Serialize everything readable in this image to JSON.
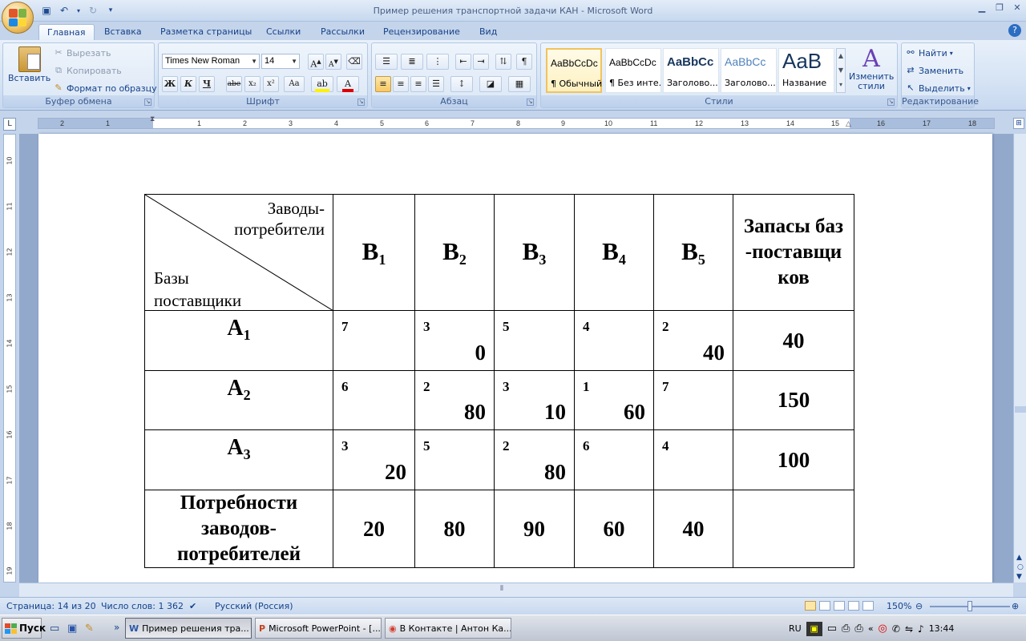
{
  "window": {
    "title": "Пример решения транспортной задачи КАН - Microsoft Word"
  },
  "tabs": [
    "Главная",
    "Вставка",
    "Разметка страницы",
    "Ссылки",
    "Рассылки",
    "Рецензирование",
    "Вид"
  ],
  "ribbon": {
    "clipboard": {
      "paste": "Вставить",
      "cut": "Вырезать",
      "copy": "Копировать",
      "format_painter": "Формат по образцу",
      "label": "Буфер обмена"
    },
    "font": {
      "name": "Times New Roman",
      "size": "14",
      "label": "Шрифт",
      "bold": "Ж",
      "italic": "К",
      "underline": "Ч",
      "strike": "abe",
      "subscript": "x₂",
      "superscript": "x²",
      "change_case": "Aa"
    },
    "paragraph": {
      "label": "Абзац"
    },
    "styles": {
      "label": "Стили",
      "items": [
        {
          "preview": "AaBbCcDc",
          "name": "¶ Обычный"
        },
        {
          "preview": "AaBbCcDc",
          "name": "¶ Без инте..."
        },
        {
          "preview": "AaBbCc",
          "name": "Заголово..."
        },
        {
          "preview": "AaBbCc",
          "name": "Заголово..."
        },
        {
          "preview": "AaB",
          "name": "Название"
        }
      ],
      "change_styles": "Изменить стили"
    },
    "editing": {
      "label": "Редактирование",
      "find": "Найти",
      "replace": "Заменить",
      "select": "Выделить"
    }
  },
  "ruler": {
    "numbers": [
      "2",
      "1",
      "1",
      "2",
      "3",
      "4",
      "5",
      "6",
      "7",
      "8",
      "9",
      "10",
      "11",
      "12",
      "13",
      "14",
      "15",
      "16",
      "17",
      "18"
    ],
    "vnumbers": [
      "10",
      "11",
      "12",
      "13",
      "14",
      "15",
      "16",
      "17",
      "18",
      "19"
    ]
  },
  "table": {
    "corner_top": "Заводы-потребители",
    "corner_bottom": "Базы поставщики",
    "col_headers": [
      {
        "letter": "B",
        "index": "1"
      },
      {
        "letter": "B",
        "index": "2"
      },
      {
        "letter": "B",
        "index": "3"
      },
      {
        "letter": "B",
        "index": "4"
      },
      {
        "letter": "B",
        "index": "5"
      }
    ],
    "stock_header": "Запасы баз-поставщиков",
    "rows": [
      {
        "letter": "A",
        "index": "1",
        "cells": [
          {
            "cost": "7",
            "alloc": ""
          },
          {
            "cost": "3",
            "alloc": "0"
          },
          {
            "cost": "5",
            "alloc": ""
          },
          {
            "cost": "4",
            "alloc": ""
          },
          {
            "cost": "2",
            "alloc": "40"
          }
        ],
        "stock": "40"
      },
      {
        "letter": "A",
        "index": "2",
        "cells": [
          {
            "cost": "6",
            "alloc": ""
          },
          {
            "cost": "2",
            "alloc": "80"
          },
          {
            "cost": "3",
            "alloc": "10"
          },
          {
            "cost": "1",
            "alloc": "60"
          },
          {
            "cost": "7",
            "alloc": ""
          }
        ],
        "stock": "150"
      },
      {
        "letter": "A",
        "index": "3",
        "cells": [
          {
            "cost": "3",
            "alloc": "20"
          },
          {
            "cost": "5",
            "alloc": ""
          },
          {
            "cost": "2",
            "alloc": "80"
          },
          {
            "cost": "6",
            "alloc": ""
          },
          {
            "cost": "4",
            "alloc": ""
          }
        ],
        "stock": "100"
      }
    ],
    "demand_label": "Потребности заводов-потребителей",
    "demand": [
      "20",
      "80",
      "90",
      "60",
      "40"
    ]
  },
  "status": {
    "page": "Страница: 14 из 20",
    "words": "Число слов: 1 362",
    "language": "Русский (Россия)",
    "zoom": "150%"
  },
  "taskbar": {
    "start": "Пуск",
    "items": [
      "Пример решения тра...",
      "Microsoft PowerPoint - [...",
      "В Контакте | Антон Ка..."
    ],
    "lang": "RU",
    "clock": "13:44"
  }
}
